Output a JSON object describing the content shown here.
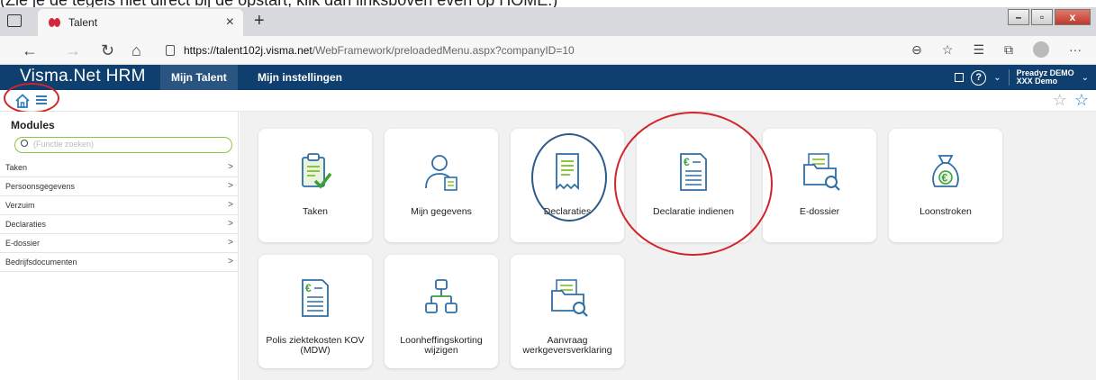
{
  "caption": "(Zie je de tegels niet direct bij de opstart, klik dan linksboven even op HOME.)",
  "browser": {
    "tab_title": "Talent",
    "tab_close": "×",
    "new_tab": "+",
    "url_host": "https://talent102j.visma.net",
    "url_path": "/WebFramework/preloadedMenu.aspx?companyID=10",
    "back": "←",
    "forward": "→",
    "reload": "↻",
    "home": "⌂",
    "more": "···",
    "win_min": "–",
    "win_max": "▫",
    "win_close": "x"
  },
  "app": {
    "brand": "Visma.Net HRM",
    "nav_tabs": [
      "Mijn Talent",
      "Mijn instellingen"
    ],
    "user_line1": "Preadyz DEMO",
    "user_line2": "XXX Demo",
    "help": "?"
  },
  "sidebar": {
    "title": "Modules",
    "search_placeholder": "(Functie zoeken)",
    "items": [
      {
        "label": "Taken",
        "chevron": ">"
      },
      {
        "label": "Persoonsgegevens",
        "chevron": ">"
      },
      {
        "label": "Verzuim",
        "chevron": ">"
      },
      {
        "label": "Declaraties",
        "chevron": ">"
      },
      {
        "label": "E-dossier",
        "chevron": ">"
      },
      {
        "label": "Bedrijfsdocumenten",
        "chevron": ">"
      }
    ]
  },
  "tiles": [
    {
      "label": "Taken",
      "icon": "clipboard-check-icon"
    },
    {
      "label": "Mijn gegevens",
      "icon": "person-document-icon"
    },
    {
      "label": "Declaraties",
      "icon": "receipt-icon"
    },
    {
      "label": "Declaratie indienen",
      "icon": "euro-document-icon"
    },
    {
      "label": "E-dossier",
      "icon": "folder-search-icon"
    },
    {
      "label": "Loonstroken",
      "icon": "money-bag-icon"
    },
    {
      "label": "Polis ziektekosten KOV (MDW)",
      "icon": "euro-document-icon"
    },
    {
      "label": "Loonheffingskorting wijzigen",
      "icon": "org-chart-icon"
    },
    {
      "label": "Aanvraag werkgeversverklaring",
      "icon": "folder-search-icon"
    }
  ],
  "colors": {
    "header": "#0f3f6e",
    "accent_green": "#8cc63f",
    "annotation_red": "#d0252a",
    "annotation_blue": "#2e5a88"
  }
}
